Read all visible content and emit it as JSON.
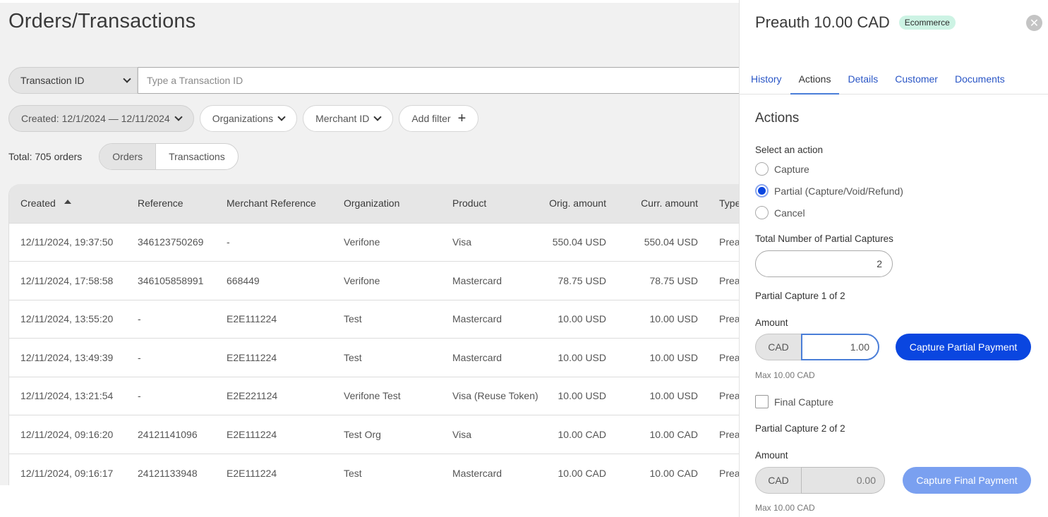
{
  "main": {
    "title": "Orders/Transactions",
    "search": {
      "type_label": "Transaction ID",
      "placeholder": "Type a Transaction ID",
      "value": ""
    },
    "filters": {
      "created": "Created: 12/1/2024 — 12/11/2024",
      "organizations": "Organizations",
      "merchant_id": "Merchant ID",
      "add_filter": "Add filter"
    },
    "total": "Total: 705 orders",
    "view_toggle": {
      "selected": "Orders",
      "options": [
        "Orders",
        "Transactions"
      ]
    },
    "table": {
      "columns": [
        "Created",
        "Reference",
        "Merchant Reference",
        "Organization",
        "Product",
        "Orig. amount",
        "Curr. amount",
        "Type"
      ],
      "sort_column": "Created",
      "rows": [
        [
          "12/11/2024, 19:37:50",
          "346123750269",
          "-",
          "Verifone",
          "Visa",
          "550.04 USD",
          "550.04 USD",
          "Prea"
        ],
        [
          "12/11/2024, 17:58:58",
          "346105858991",
          "668449",
          "Verifone",
          "Mastercard",
          "78.75 USD",
          "78.75 USD",
          "Prea"
        ],
        [
          "12/11/2024, 13:55:20",
          "-",
          "E2E111224",
          "Test",
          "Mastercard",
          "10.00 USD",
          "10.00 USD",
          "Prea"
        ],
        [
          "12/11/2024, 13:49:39",
          "-",
          "E2E111224",
          "Test",
          "Mastercard",
          "10.00 USD",
          "10.00 USD",
          "Prea"
        ],
        [
          "12/11/2024, 13:21:54",
          "-",
          "E2E221124",
          "Verifone Test",
          "Visa (Reuse Token)",
          "10.00 USD",
          "10.00 USD",
          "Prea"
        ],
        [
          "12/11/2024, 09:16:20",
          "24121141096",
          "E2E111224",
          "Test Org",
          "Visa",
          "10.00 CAD",
          "10.00 CAD",
          "Prea"
        ],
        [
          "12/11/2024, 09:16:17",
          "24121133948",
          "E2E111224",
          "Test",
          "Mastercard",
          "10.00 CAD",
          "10.00 CAD",
          "Prea"
        ]
      ]
    }
  },
  "panel": {
    "title": "Preauth 10.00 CAD",
    "badge": "Ecommerce",
    "close_icon": "close-circle-icon",
    "tabs": [
      "History",
      "Actions",
      "Details",
      "Customer",
      "Documents"
    ],
    "active_tab": "Actions",
    "actions_heading": "Actions",
    "select_action_label": "Select an action",
    "action_options": [
      {
        "label": "Capture",
        "selected": false
      },
      {
        "label": "Partial (Capture/Void/Refund)",
        "selected": true
      },
      {
        "label": "Cancel",
        "selected": false
      }
    ],
    "total_partial_label": "Total Number of Partial Captures",
    "total_partial_value": "2",
    "capture1": {
      "heading": "Partial Capture 1 of 2",
      "amount_label": "Amount",
      "currency": "CAD",
      "value": "1.00",
      "button": "Capture Partial Payment",
      "hint": "Max 10.00 CAD"
    },
    "final_capture_label": "Final Capture",
    "final_capture_checked": false,
    "capture2": {
      "heading": "Partial Capture 2 of 2",
      "amount_label": "Amount",
      "currency": "CAD",
      "value": "0.00",
      "button": "Capture Final Payment",
      "hint": "Max 10.00 CAD"
    }
  },
  "colors": {
    "primary": "#0a46e0",
    "primary_disabled": "#7aa0f0",
    "tab_link": "#2a56c6",
    "badge_bg": "#cdf3e4"
  }
}
